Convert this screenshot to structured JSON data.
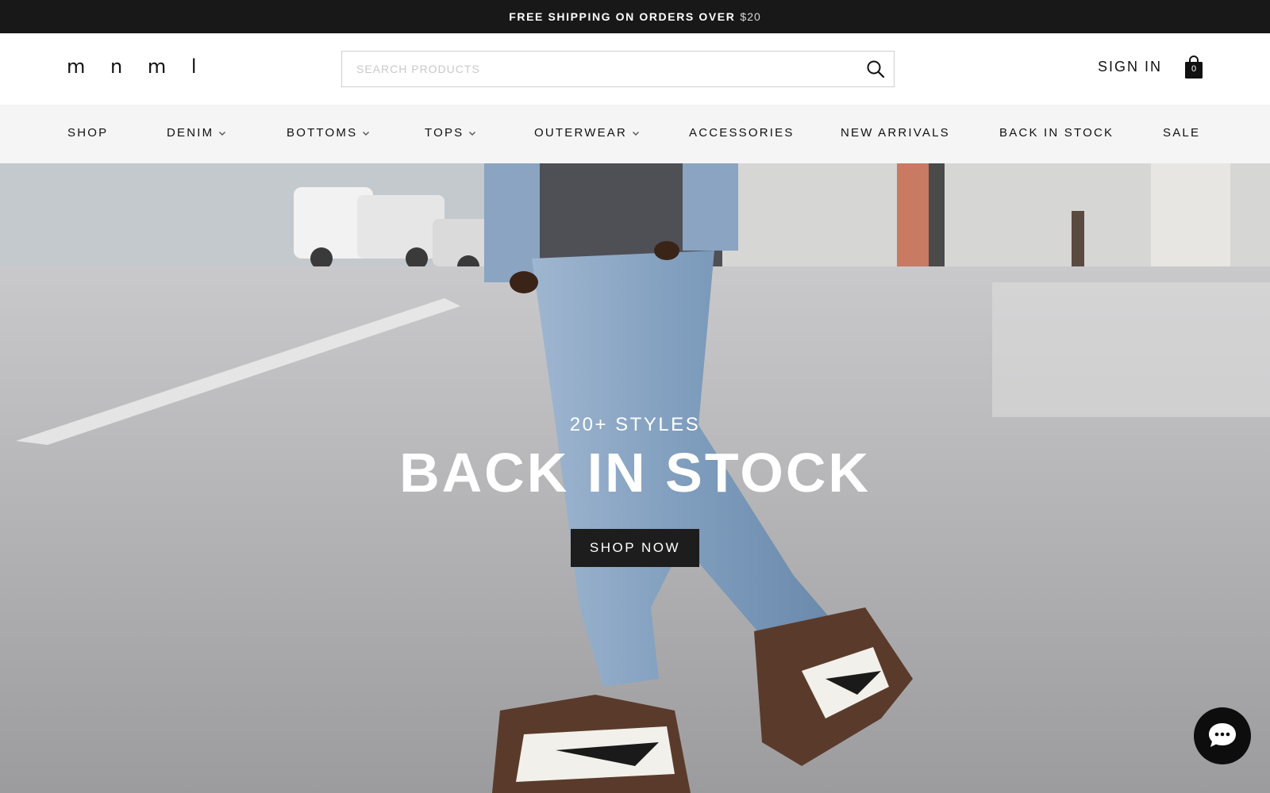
{
  "promo": {
    "text": "FREE SHIPPING ON ORDERS OVER",
    "amount": "$20"
  },
  "header": {
    "logo": "m n m l",
    "search_placeholder": "SEARCH PRODUCTS",
    "sign_in": "SIGN IN",
    "cart_count": "0"
  },
  "nav": {
    "items": [
      {
        "label": "SHOP",
        "has_dropdown": false
      },
      {
        "label": "DENIM",
        "has_dropdown": true
      },
      {
        "label": "BOTTOMS",
        "has_dropdown": true
      },
      {
        "label": "TOPS",
        "has_dropdown": true
      },
      {
        "label": "OUTERWEAR",
        "has_dropdown": true
      },
      {
        "label": "ACCESSORIES",
        "has_dropdown": false
      },
      {
        "label": "NEW ARRIVALS",
        "has_dropdown": false
      },
      {
        "label": "BACK IN STOCK",
        "has_dropdown": false
      },
      {
        "label": "SALE",
        "has_dropdown": false
      }
    ]
  },
  "hero": {
    "subtitle": "20+ STYLES",
    "title": "BACK IN STOCK",
    "cta": "SHOP NOW"
  },
  "colors": {
    "promo_bg": "#181818",
    "nav_bg": "#f5f5f5",
    "button_bg": "#1d1d1d",
    "chat_bg": "#0d0d0d"
  },
  "icons": {
    "search": "search-icon",
    "cart": "shopping-bag-icon",
    "chevron": "chevron-down-icon",
    "chat": "chat-bubble-icon"
  }
}
